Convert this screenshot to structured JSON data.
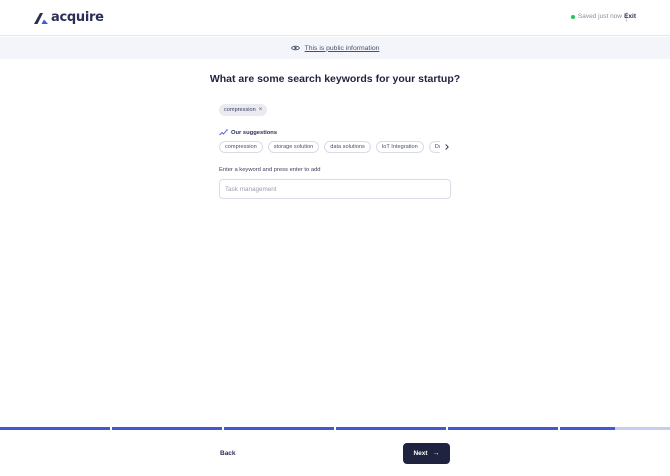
{
  "header": {
    "logo_text": "acquire",
    "saved_text": "Saved just now",
    "exit_label": "Exit",
    "status_color": "#22c55e"
  },
  "notice": {
    "text": "This is public information",
    "icon": "eye-icon"
  },
  "main": {
    "title": "What are some search keywords for your startup?",
    "selected_keywords": [
      "compression"
    ],
    "remove_icon": "×",
    "suggestions_label": "Our suggestions",
    "suggestions": [
      "compression",
      "storage solution",
      "data solutions",
      "IoT Integration",
      "Data Management"
    ],
    "input_label": "Enter a keyword and press enter to add",
    "input_placeholder": "Task management"
  },
  "progress": {
    "segments": [
      1,
      1,
      1,
      1,
      1,
      0.5
    ]
  },
  "footer": {
    "back_label": "Back",
    "next_label": "Next",
    "next_arrow": "→"
  },
  "colors": {
    "brand": "#2b2f57",
    "accent": "#4458d6",
    "primary_button": "#1f2340"
  }
}
